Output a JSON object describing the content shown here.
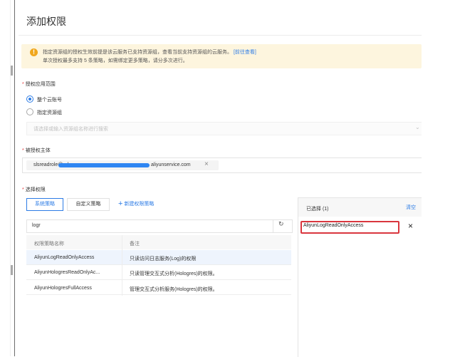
{
  "page": {
    "title": "添加权限"
  },
  "notice": {
    "line1": "指定资源组的授权生效前提是该云服务已支持资源组，查看当前支持资源组的云服务。",
    "link": "[前往查看]",
    "line2": "单次授权最多支持 5 条策略，如需绑定更多策略，请分多次进行。",
    "icon": "warning-icon",
    "color": "#f0a71d"
  },
  "scope": {
    "label": "授权应用范围",
    "required_mark": "*",
    "options": [
      {
        "label": "整个云账号",
        "selected": true
      },
      {
        "label": "指定资源组",
        "selected": false
      }
    ],
    "resource_group_placeholder": "请选择或输入资源组名称进行搜索"
  },
  "principal": {
    "label": "被授权主体",
    "required_mark": "*",
    "tag_prefix": "slsreadrole@role",
    "tag_suffix": "aliyunservice.com",
    "close_glyph": "×"
  },
  "policies": {
    "label": "选择权限",
    "required_mark": "*",
    "tabs": [
      {
        "label": "系统策略",
        "active": true
      },
      {
        "label": "自定义策略",
        "active": false
      }
    ],
    "new_policy_plus": "+",
    "new_policy_label": "新建权限策略",
    "search_value": "logr",
    "refresh_glyph": "↻",
    "columns": [
      "权限策略名称",
      "备注"
    ],
    "rows": [
      {
        "name": "AliyunLogReadOnlyAccess",
        "note": "只读访问日志服务(Log)的权限",
        "highlighted": true
      },
      {
        "name": "AliyunHologresReadOnlyAc...",
        "note": "只读管理交互式分析(Hologres)的权限。",
        "highlighted": false
      },
      {
        "name": "AliyunHologresFullAccess",
        "note": "管理交互式分析服务(Hologres)的权限。",
        "highlighted": false
      }
    ]
  },
  "selected_panel": {
    "title": "已选择 (1)",
    "clear_label": "清空",
    "items": [
      {
        "name": "AliyunLogReadOnlyAccess"
      }
    ],
    "remove_glyph": "×"
  },
  "colors": {
    "accent": "#2d7ce5",
    "highlight_border": "#d9363e",
    "required": "#e5393b"
  }
}
